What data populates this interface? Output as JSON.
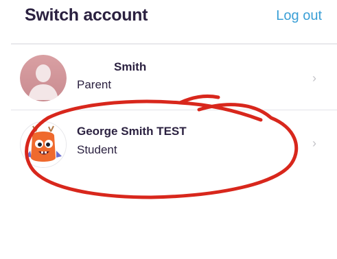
{
  "header": {
    "title": "Switch account",
    "logout_label": "Log out"
  },
  "accounts": [
    {
      "name": "Smith",
      "role": "Parent",
      "avatar_icon": "default-person-avatar"
    },
    {
      "name": "George Smith TEST",
      "role": "Student",
      "avatar_icon": "orange-monster-avatar"
    }
  ],
  "colors": {
    "title": "#2b2140",
    "link": "#3a9fd6",
    "annotation": "#d8271c"
  }
}
